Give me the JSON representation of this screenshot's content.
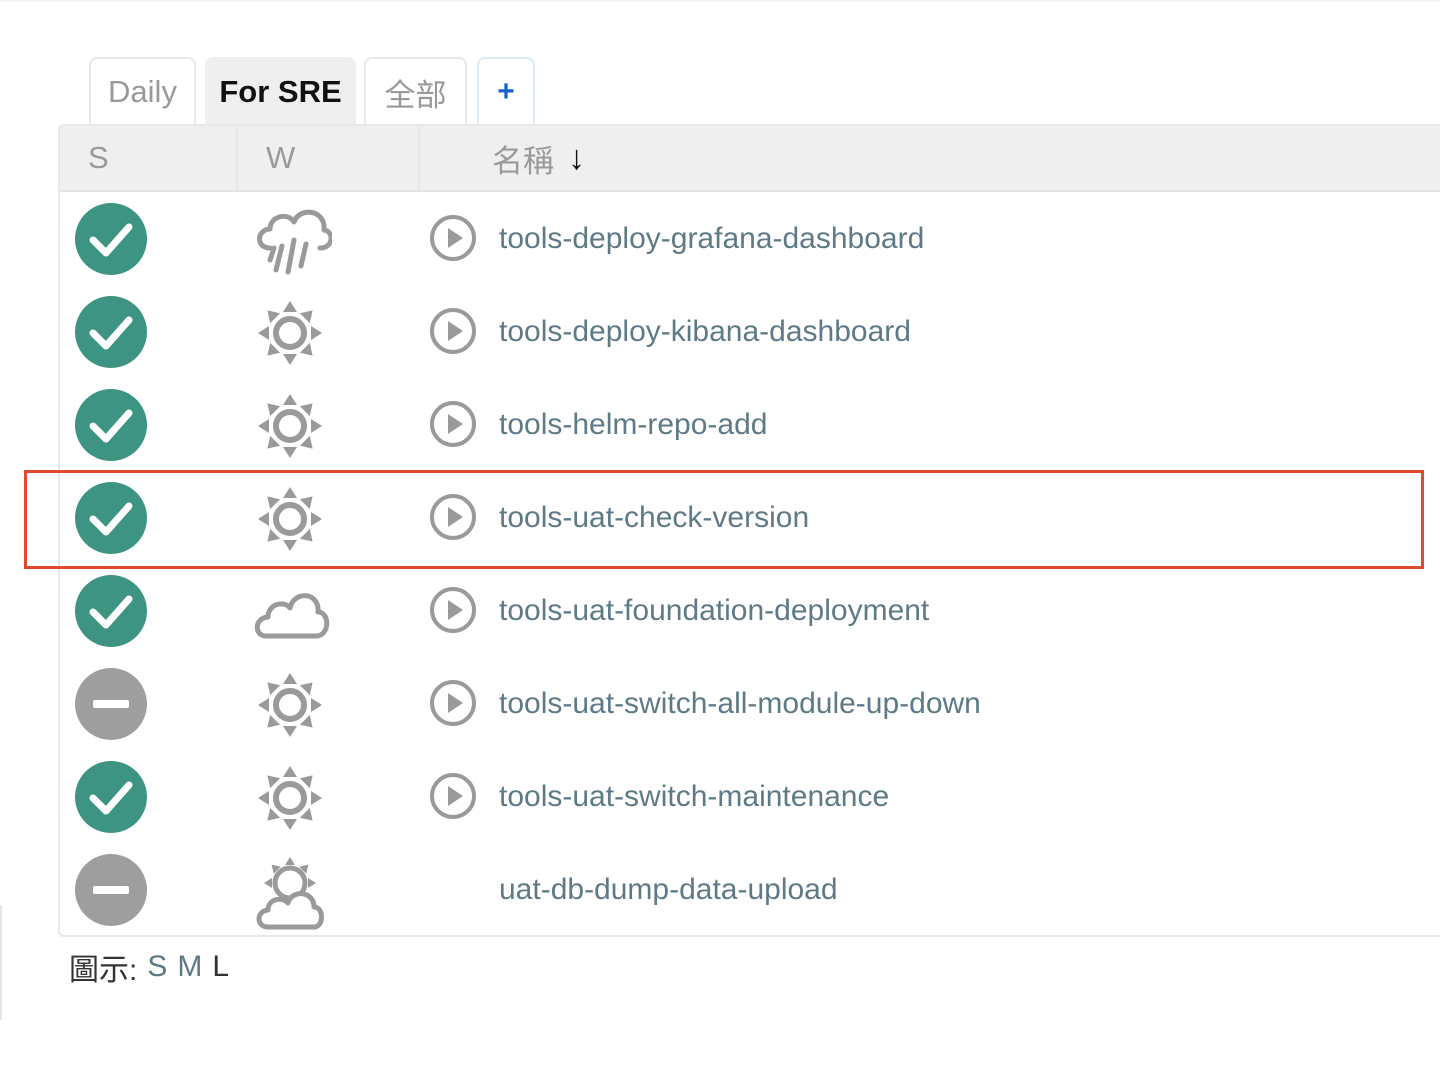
{
  "tabs": [
    {
      "label": "Daily",
      "active": false
    },
    {
      "label": "For SRE",
      "active": true
    },
    {
      "label": "全部",
      "active": false
    },
    {
      "label": "+",
      "active": false
    }
  ],
  "table": {
    "headers": {
      "status": "S",
      "weather": "W",
      "name": "名稱",
      "sort_indicator": "↓"
    },
    "rows": [
      {
        "status": "success",
        "weather": "rain-icon",
        "has_build_button": true,
        "name": "tools-deploy-grafana-dashboard"
      },
      {
        "status": "success",
        "weather": "sun-icon",
        "has_build_button": true,
        "name": "tools-deploy-kibana-dashboard"
      },
      {
        "status": "success",
        "weather": "sun-icon",
        "has_build_button": true,
        "name": "tools-helm-repo-add"
      },
      {
        "status": "success",
        "weather": "sun-icon",
        "has_build_button": true,
        "name": "tools-uat-check-version",
        "highlighted": true
      },
      {
        "status": "success",
        "weather": "cloud-icon",
        "has_build_button": true,
        "name": "tools-uat-foundation-deployment"
      },
      {
        "status": "disabled",
        "weather": "sun-icon",
        "has_build_button": true,
        "name": "tools-uat-switch-all-module-up-down"
      },
      {
        "status": "success",
        "weather": "sun-icon",
        "has_build_button": true,
        "name": "tools-uat-switch-maintenance"
      },
      {
        "status": "disabled",
        "weather": "partly-cloudy-icon",
        "has_build_button": false,
        "name": "uat-db-dump-data-upload"
      }
    ]
  },
  "legend": {
    "label": "圖示:",
    "sizes": [
      "S",
      "M",
      "L"
    ]
  },
  "colors": {
    "success": "#3d9482",
    "disabled": "#9e9e9e",
    "icon_gray": "#9a9a9a",
    "link": "#5e7a87",
    "highlight": "#e04a2f",
    "add_tab": "#1a62d1"
  }
}
